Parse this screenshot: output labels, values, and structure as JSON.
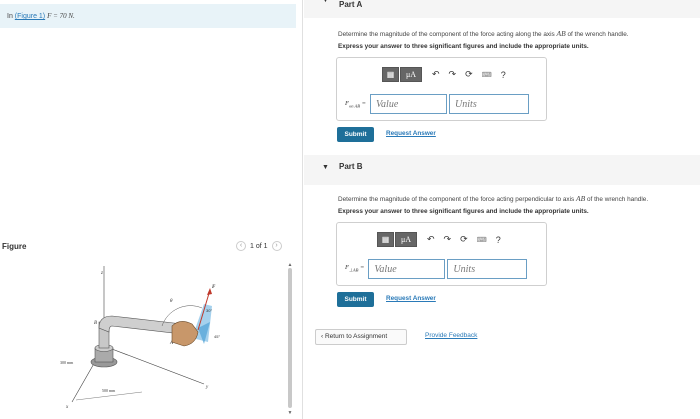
{
  "intro": {
    "prefix": "In",
    "figure_link": "(Figure 1)",
    "statement": "F = 70 N."
  },
  "figure": {
    "label": "Figure",
    "pager_text": "1 of 1",
    "labels": {
      "z": "z",
      "y": "y",
      "x": "x",
      "B": "B",
      "A": "A",
      "F": "F",
      "theta": "θ",
      "angle_30": "30°",
      "angle_45": "45°",
      "dim_300": "300 mm",
      "dim_500": "500 mm"
    }
  },
  "partA": {
    "header": "Part A",
    "description_pre": "Determine the magnitude of the component of the force acting along the axis",
    "description_axis": "AB",
    "description_post": "of the wrench handle.",
    "instruction": "Express your answer to three significant figures and include the appropriate units.",
    "toolbar": {
      "matrix": "▦",
      "mu": "μA",
      "undo": "↶",
      "redo": "↷",
      "reset": "⟳",
      "keyboard": "⌨",
      "help": "?"
    },
    "field_label_main": "F",
    "field_label_sub": "on AB",
    "field_label_eq": " =",
    "value_placeholder": "Value",
    "units_placeholder": "Units",
    "submit": "Submit",
    "request": "Request Answer"
  },
  "partB": {
    "header": "Part B",
    "description_pre": "Determine the magnitude of the component of the force acting perpendicular to axis",
    "description_axis": "AB",
    "description_post": "of the wrench handle.",
    "instruction": "Express your answer to three significant figures and include the appropriate units.",
    "toolbar": {
      "matrix": "▦",
      "mu": "μA",
      "undo": "↶",
      "redo": "↷",
      "reset": "⟳",
      "keyboard": "⌨",
      "help": "?"
    },
    "field_label_main": "F",
    "field_label_sub": "⊥AB",
    "field_label_eq": " =",
    "value_placeholder": "Value",
    "units_placeholder": "Units",
    "submit": "Submit",
    "request": "Request Answer"
  },
  "footer": {
    "return": "Return to Assignment",
    "return_icon": "‹",
    "feedback": "Provide Feedback"
  },
  "colors": {
    "accent": "#1e6f99",
    "link": "#2a7ab8",
    "intro_bg": "#e8f3f8",
    "header_bg": "#f5f5f5"
  }
}
